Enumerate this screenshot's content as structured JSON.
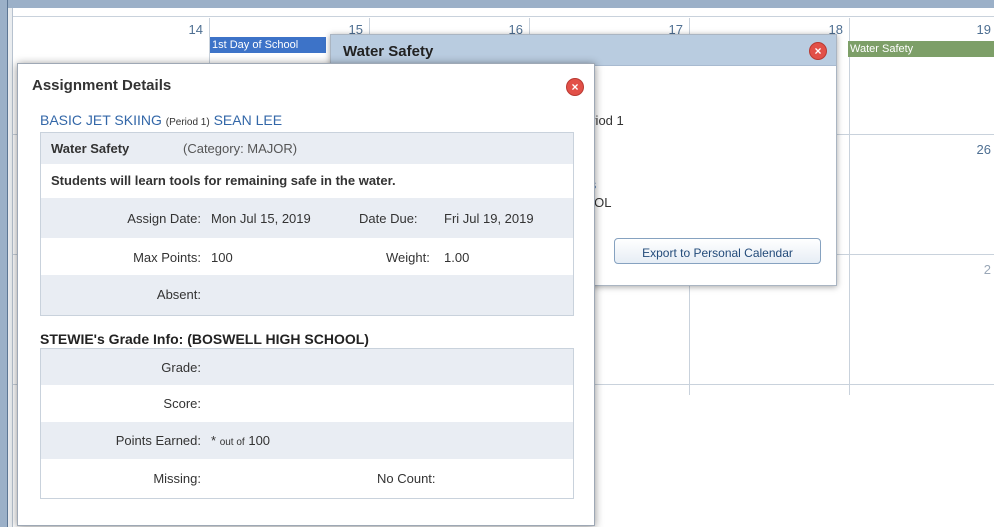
{
  "calendar": {
    "days_row1": [
      "14",
      "15",
      "16",
      "17",
      "18",
      "19"
    ],
    "days_row2": [
      "26"
    ],
    "days_row3": [
      "2"
    ],
    "events": [
      {
        "label": "1st Day of School"
      },
      {
        "label": "Water Safety"
      }
    ]
  },
  "popover": {
    "title": "Water Safety",
    "period_text": "eriod 1",
    "link_fragment": "ils",
    "school_fragment": "OOL",
    "export_label": "Export to Personal Calendar"
  },
  "modal": {
    "title": "Assignment Details",
    "course_link": "BASIC JET SKIING",
    "period": "(Period 1)",
    "teacher_link": "SEAN LEE",
    "assignment": {
      "name": "Water Safety",
      "category": "(Category: MAJOR)",
      "description": "Students will learn tools for remaining safe in the water.",
      "assign_date_label": "Assign Date:",
      "assign_date_value": "Mon Jul 15, 2019",
      "date_due_label": "Date Due:",
      "date_due_value": "Fri Jul 19, 2019",
      "max_points_label": "Max Points:",
      "max_points_value": "100",
      "weight_label": "Weight:",
      "weight_value": "1.00",
      "absent_label": "Absent:"
    },
    "grade_info_title": "STEWIE's Grade Info: (BOSWELL HIGH SCHOOL)",
    "grade": {
      "grade_label": "Grade:",
      "score_label": "Score:",
      "points_earned_label": "Points Earned:",
      "points_earned_star": "*",
      "points_earned_outof": "out of",
      "points_earned_total": "100",
      "missing_label": "Missing:",
      "no_count_label": "No Count:"
    }
  }
}
